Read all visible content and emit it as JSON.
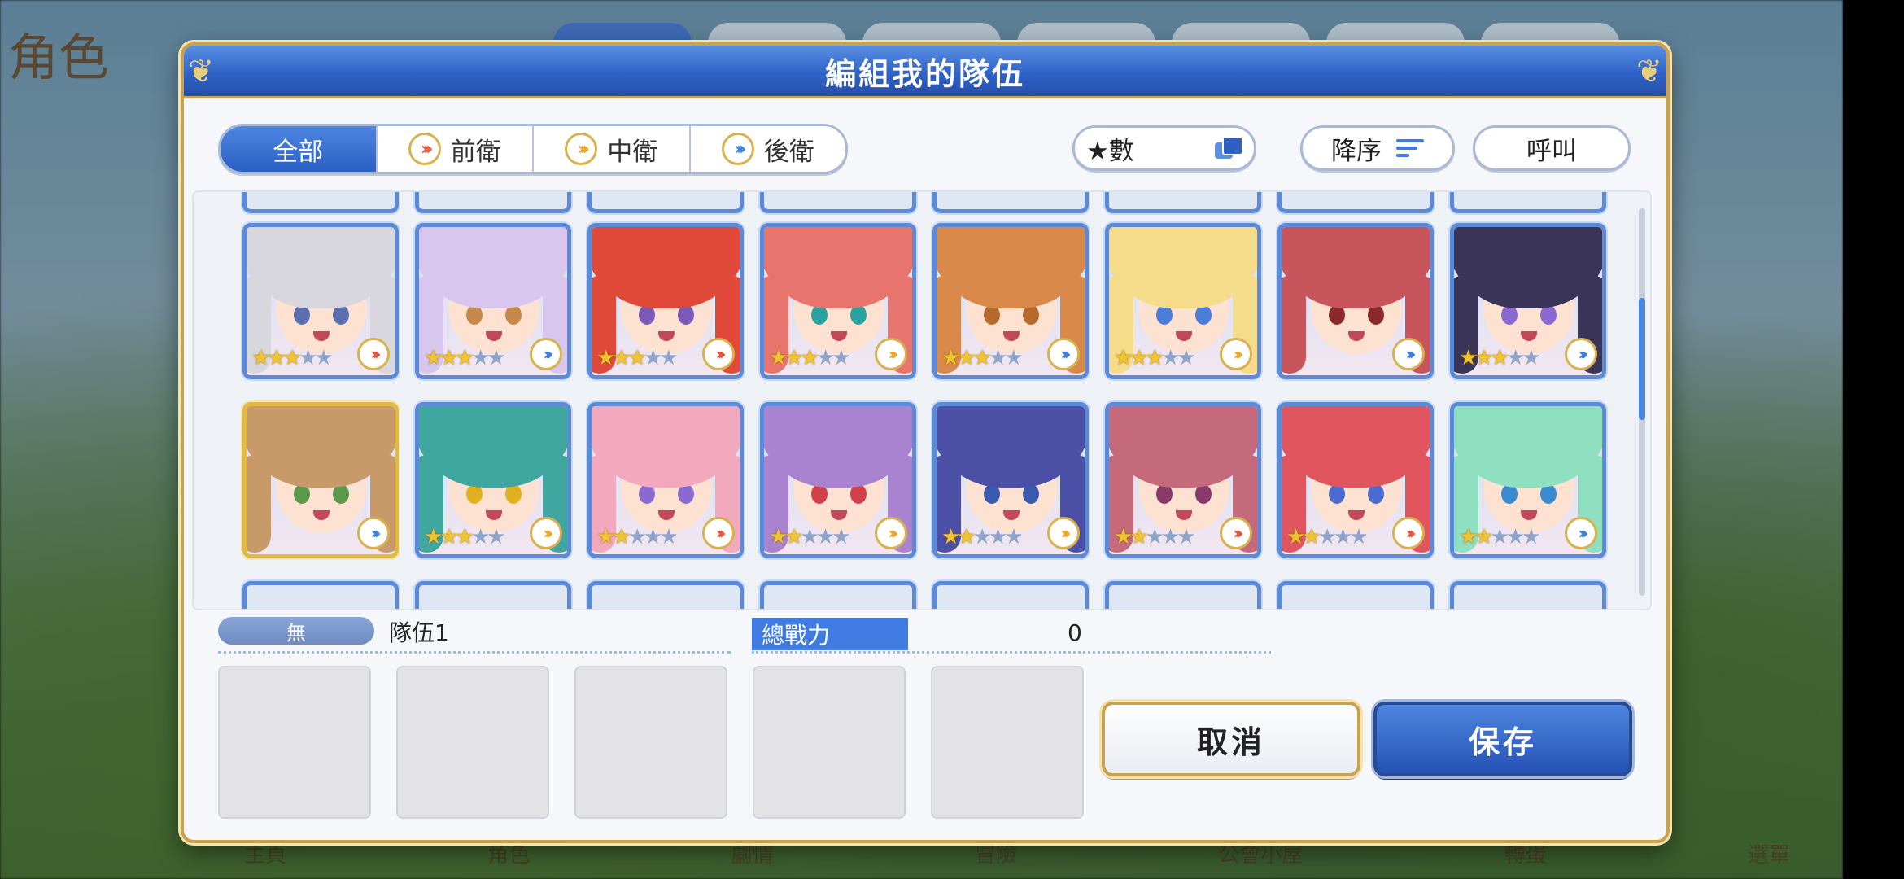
{
  "background": {
    "screen_title": "角色",
    "nav_items": [
      "主頁",
      "角色",
      "劇情",
      "冒險",
      "公會小屋",
      "轉蛋",
      "選單"
    ]
  },
  "dialog": {
    "title": "編組我的隊伍"
  },
  "filters": {
    "tabs": [
      {
        "label": "全部",
        "icon": "none",
        "active": true
      },
      {
        "label": "前衛",
        "icon": "front-chevron-icon",
        "active": false
      },
      {
        "label": "中衛",
        "icon": "mid-chevron-icon",
        "active": false
      },
      {
        "label": "後衛",
        "icon": "back-chevron-icon",
        "active": false
      }
    ],
    "sort_key_label": "★數",
    "sort_order_label": "降序",
    "call_label": "呼叫"
  },
  "characters": [
    {
      "stars": 3,
      "role": "front",
      "hair": "#d7d7dd",
      "eye": "#5a6fb0"
    },
    {
      "stars": 3,
      "role": "back",
      "hair": "#d9c6ee",
      "eye": "#c58a4a"
    },
    {
      "stars": 3,
      "role": "front",
      "hair": "#e0483a",
      "eye": "#7a5ab8"
    },
    {
      "stars": 3,
      "role": "mid",
      "hair": "#e8746e",
      "eye": "#2aa3a0"
    },
    {
      "stars": 3,
      "role": "back",
      "hair": "#d9894a",
      "eye": "#b46a2a"
    },
    {
      "stars": 3,
      "role": "mid",
      "hair": "#f5dc8a",
      "eye": "#4a7ed8"
    },
    {
      "stars": 0,
      "role": "back",
      "hair": "#c9555c",
      "eye": "#8a2a2a"
    },
    {
      "stars": 3,
      "role": "back",
      "hair": "#3a3458",
      "eye": "#8a6ad0"
    },
    {
      "stars": 0,
      "role": "back",
      "hair": "#c89a6a",
      "eye": "#5a9a4a",
      "gold": true
    },
    {
      "stars": 3,
      "role": "mid",
      "hair": "#3fa6a0",
      "eye": "#e0b020"
    },
    {
      "stars": 2,
      "role": "front",
      "hair": "#f3a9bd",
      "eye": "#8a6ad0"
    },
    {
      "stars": 2,
      "role": "mid",
      "hair": "#a983cf",
      "eye": "#d0404a"
    },
    {
      "stars": 2,
      "role": "mid",
      "hair": "#4c4fa6",
      "eye": "#3a5ab0"
    },
    {
      "stars": 2,
      "role": "front",
      "hair": "#c46a7a",
      "eye": "#8a3a6a"
    },
    {
      "stars": 2,
      "role": "front",
      "hair": "#e0555e",
      "eye": "#4a6ad0"
    },
    {
      "stars": 2,
      "role": "back",
      "hair": "#8ee0c0",
      "eye": "#3a8ad0"
    }
  ],
  "party": {
    "tag_label": "無",
    "name": "隊伍1",
    "power_label": "總戰力",
    "power_value": "0",
    "slot_count": 5
  },
  "buttons": {
    "cancel_label": "取消",
    "save_label": "保存"
  },
  "colors": {
    "accent_blue": "#2f63c9",
    "gold_frame": "#c8a24f",
    "front_role": "#e2553f",
    "mid_role": "#e8a62c",
    "back_role": "#3d7fd9"
  }
}
